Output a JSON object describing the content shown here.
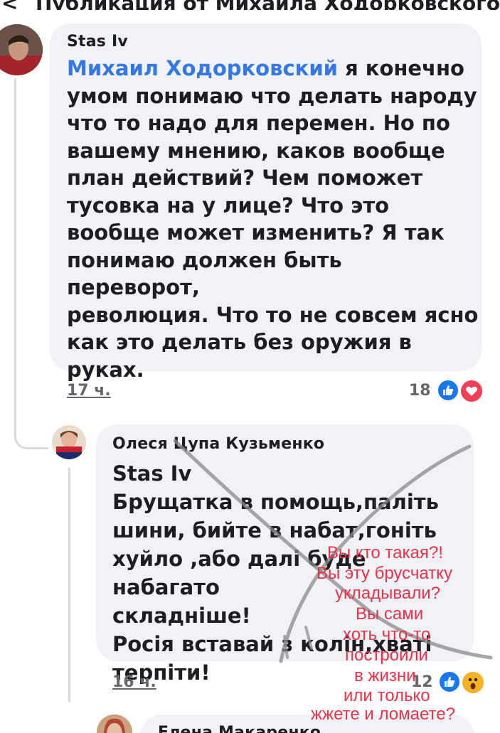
{
  "header": {
    "back_glyph": "<",
    "title": "Публикация от Михаила Ходорковского"
  },
  "comments": [
    {
      "author": "Stas Iv",
      "mention": "Михаил Ходорковский",
      "lines": [
        " я конечно",
        "умом понимаю что делать народу",
        "что то надо для перемен. Но по",
        "вашему мнению, каков вообще",
        "план действий? Чем поможет",
        "тусовка на у лице? Что это",
        "вообще может изменить? Я так",
        "понимаю должен быть переворот,",
        "революция. Что то не совсем ясно",
        "как это делать без оружия в",
        "руках."
      ],
      "time": "17 ч.",
      "reaction_count": "18",
      "reactions": [
        "like-icon",
        "love-icon"
      ]
    },
    {
      "author": "Олеся Цупа Кузьменко",
      "lines": [
        "Stas Iv",
        "Брущатка в помощь,паліть",
        "шини, бийте в набат,гоніть",
        "хуйло ,або далі буде набагато",
        "складніше!",
        "Росія вставай з колін,хваті",
        "терпіти!"
      ],
      "time": "16 ч.",
      "reaction_count": "12",
      "reactions": [
        "like-icon",
        "wow-icon"
      ]
    },
    {
      "author": "Елена Макаренко"
    }
  ],
  "annotation": {
    "color": "#e8334a",
    "lines": [
      "Вы кто такая?!",
      "Вы эту брусчатку",
      "укладывали?",
      "Вы сами",
      "хоть что-то",
      "построили",
      "в жизни",
      "или только",
      "жжете и ломаете?"
    ]
  }
}
